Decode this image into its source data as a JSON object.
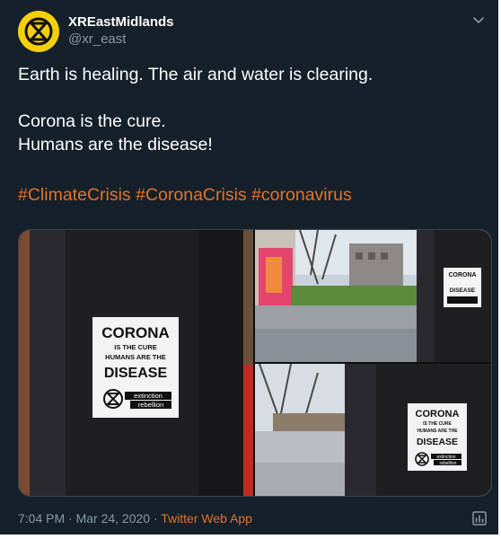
{
  "account": {
    "display_name": "XREastMidlands",
    "handle": "@xr_east",
    "avatar_icon": "extinction-rebellion-hourglass-icon",
    "avatar_color": "#f5cf0a"
  },
  "tweet": {
    "line1": "Earth is healing. The air and water is clearing.",
    "line2": "Corona is the cure.",
    "line3": "Humans are the disease!",
    "hashtags": [
      "#ClimateCrisis",
      "#CoronaCrisis",
      "#coronavirus"
    ],
    "accent_color": "#e0732d"
  },
  "stickers": {
    "line1": "CORONA",
    "line2": "IS THE CURE",
    "line3": "HUMANS ARE THE",
    "line4": "DISEASE",
    "logo_line1": "extinction",
    "logo_line2": "rebellion"
  },
  "footer": {
    "timestamp": "7:04 PM · Mar 24, 2020 · ",
    "app": "Twitter Web App"
  },
  "icons": {
    "menu": "chevron-down-icon",
    "analytics": "analytics-icon"
  },
  "colors": {
    "background": "#15202b",
    "secondary_text": "#8899a6"
  }
}
